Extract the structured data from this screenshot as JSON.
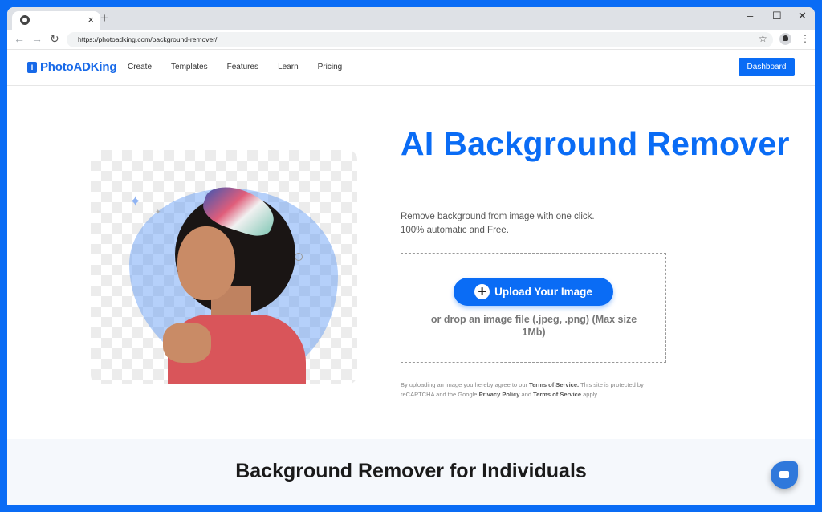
{
  "browser": {
    "tab": {
      "favicon": "chrome-icon",
      "close": "×"
    },
    "new_tab": "+",
    "window_controls": {
      "minimize": "–",
      "maximize": "☐",
      "close": "✕"
    },
    "nav": {
      "back": "←",
      "forward": "→",
      "reload": "↻"
    },
    "url": "https://photoadking.com/background-remover/",
    "bookmark": "☆",
    "menu": "⋮"
  },
  "site": {
    "logo_mark": "I",
    "logo_text": "PhotoADKing",
    "menu": [
      "Create",
      "Templates",
      "Features",
      "Learn",
      "Pricing"
    ],
    "dashboard_label": "Dashboard"
  },
  "hero": {
    "title": "AI Background Remover",
    "subtitle_line1": "Remove background from image with one click.",
    "subtitle_line2": "100% automatic and Free.",
    "upload_label": "Upload Your Image",
    "drop_hint": "or drop an image file (.jpeg, .png) (Max size 1Mb)",
    "legal": {
      "p1": "By uploading an image you hereby agree to our ",
      "tos1": "Terms of Service.",
      "p2": " This site is protected by reCAPTCHA and the Google ",
      "privacy": "Privacy Policy",
      "p3": " and ",
      "tos2": "Terms of Service",
      "p4": " apply."
    }
  },
  "section2": {
    "title": "Background Remover for Individuals"
  },
  "colors": {
    "brand": "#0a6cf5",
    "frame": "#0a6cf5"
  }
}
